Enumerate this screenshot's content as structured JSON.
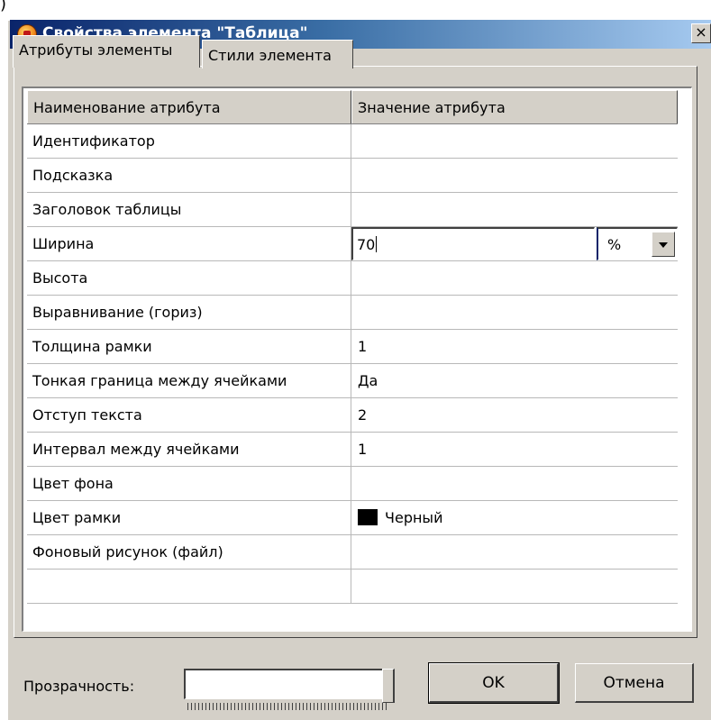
{
  "window": {
    "title": "Свойства элемента \"Таблица\"",
    "close_label": "×"
  },
  "tabs": [
    {
      "label": "Атрибуты элементы",
      "active": true
    },
    {
      "label": "Стили элемента",
      "active": false
    }
  ],
  "grid": {
    "headers": [
      "Наименование атрибута",
      "Значение атрибута"
    ],
    "rows": [
      {
        "name": "Идентификатор",
        "value": ""
      },
      {
        "name": "Подсказка",
        "value": ""
      },
      {
        "name": "Заголовок таблицы",
        "value": ""
      },
      {
        "name": "Ширина",
        "value": "70",
        "unit": "%"
      },
      {
        "name": "Высота",
        "value": ""
      },
      {
        "name": "Выравнивание (гориз)",
        "value": ""
      },
      {
        "name": "Толщина рамки",
        "value": "1"
      },
      {
        "name": "Тонкая граница между ячейками",
        "value": "Да"
      },
      {
        "name": "Отступ текста",
        "value": "2"
      },
      {
        "name": "Интервал между ячейками",
        "value": "1"
      },
      {
        "name": "Цвет фона",
        "value": ""
      },
      {
        "name": "Цвет рамки",
        "value": "Черный",
        "swatch_color": "#000000"
      },
      {
        "name": "Фоновый рисунок (файл)",
        "value": ""
      },
      {
        "name": "",
        "value": ""
      }
    ]
  },
  "footer": {
    "transparency_label": "Прозрачность:",
    "transparency_level": 1.0,
    "ok_label": "OK",
    "cancel_label": "Отмена"
  },
  "colors": {
    "face": "#d4d0c8",
    "title_start": "#0a246a",
    "title_end": "#a6caf0"
  }
}
